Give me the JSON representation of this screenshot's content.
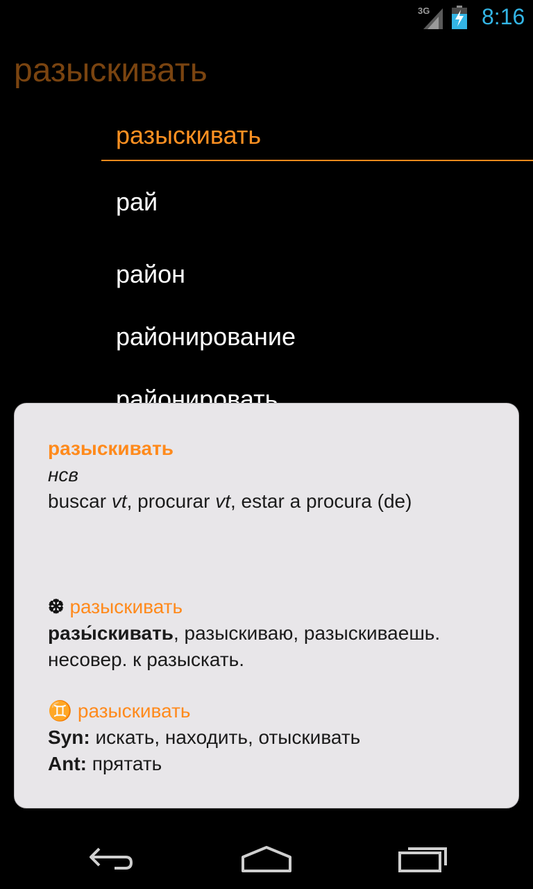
{
  "status_bar": {
    "network": "3G",
    "time": "8:16"
  },
  "query": "разыскивать",
  "word_list": [
    "разыскивать",
    "рай",
    "район",
    "районирование",
    "районировать"
  ],
  "card": {
    "headword": "разыскивать",
    "pos": "нсв",
    "translation_parts": {
      "p1": "buscar ",
      "p2": "vt",
      "p3": ", procurar ",
      "p4": "vt",
      "p5": ", estar a procura (de)"
    },
    "section2": {
      "symbol": "❆",
      "title": "разыскивать",
      "bold_word": "разы́скивать",
      "rest": ", разыскиваю, разыскиваешь. несовер. к разыскать."
    },
    "section3": {
      "symbol": "♊",
      "title": "разыскивать",
      "syn_label": "Syn:",
      "syn_text": " искать, находить, отыскивать",
      "ant_label": "Ant:",
      "ant_text": " прятать"
    }
  },
  "nav": {
    "back": "back-icon",
    "home": "home-icon",
    "recents": "recent-apps-icon"
  },
  "colors": {
    "accent": "#ff8a1c",
    "query": "#7a4410",
    "clock": "#33b5e5",
    "card_bg": "#e8e6e9"
  }
}
